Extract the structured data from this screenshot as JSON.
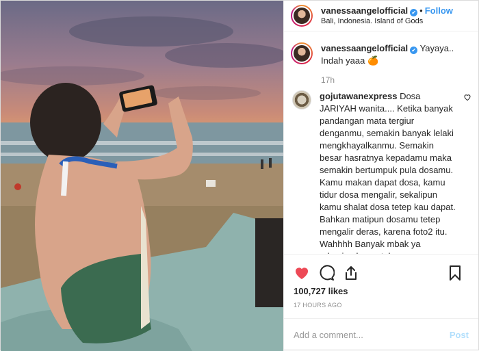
{
  "header": {
    "username": "vanessaangelofficial",
    "verified": "✔",
    "separator": "•",
    "follow_label": "Follow",
    "location": "Bali, Indonesia. Island of Gods"
  },
  "caption": {
    "username": "vanessaangelofficial",
    "verified": "✔",
    "text": "Yayaya.. Indah yaaa 🍊",
    "time": "17h"
  },
  "comment": {
    "username": "gojutawanexpress",
    "text": "Dosa JARIYAH wanita.... Ketika banyak pandangan mata tergiur denganmu, semakin banyak lelaki mengkhayalkanmu. Semakin besar hasratnya kepadamu maka semakin bertumpuk pula dosamu. Kamu makan dapat dosa, kamu tidur dosa mengalir, sekalipun kamu shalat dosa tetep kau dapat. Bahkan matipun dosamu tetep mengalir deras, karena foto2 itu. Wahhhh Banyak mbak ya rekening koran tabungan dosanya. 👏👏👏"
  },
  "stats": {
    "likes": "100,727 likes",
    "time_ago": "17 HOURS AGO"
  },
  "add_comment": {
    "placeholder": "Add a comment...",
    "post_label": "Post"
  },
  "icons": {
    "like": "heart-icon",
    "comment": "comment-icon",
    "share": "share-icon",
    "save": "bookmark-icon",
    "comment_like": "heart-outline-icon"
  },
  "colors": {
    "like_red": "#ed4956",
    "link_blue": "#3897f0",
    "muted": "#8e8e8e"
  }
}
